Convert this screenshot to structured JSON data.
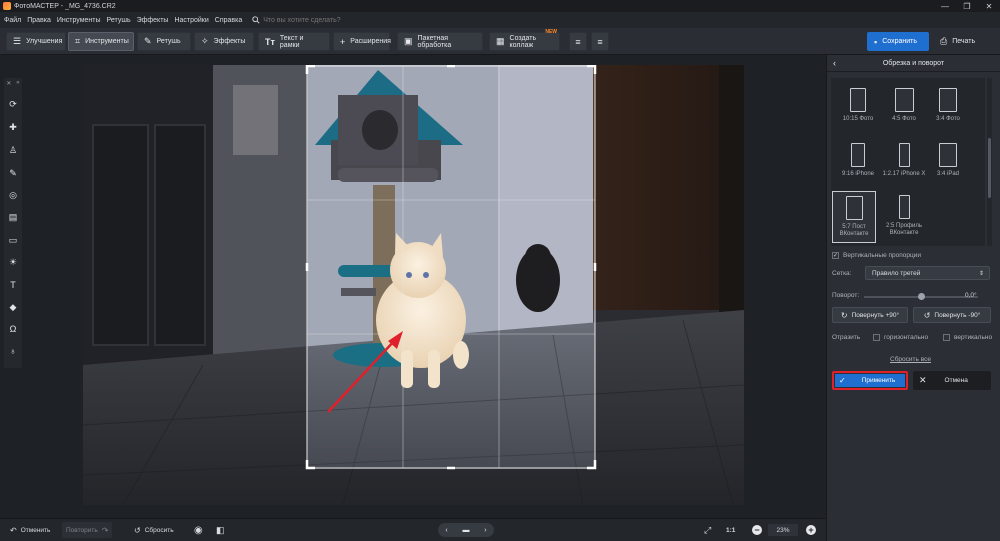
{
  "window": {
    "title": "ФотоМАСТЕР - _MG_4736.CR2",
    "minimize": "—",
    "maximize": "❐",
    "close": "✕"
  },
  "menu": {
    "items": [
      "Файл",
      "Правка",
      "Инструменты",
      "Ретушь",
      "Эффекты",
      "Настройки",
      "Справка"
    ],
    "search_placeholder": "Что вы хотите сделать?"
  },
  "toolbar": {
    "tabs": [
      {
        "label": "Улучшения",
        "icon": "sliders-icon"
      },
      {
        "label": "Инструменты",
        "icon": "crop-icon"
      },
      {
        "label": "Ретушь",
        "icon": "brush-icon"
      },
      {
        "label": "Эффекты",
        "icon": "sparkle-icon"
      },
      {
        "label": "Текст и рамки",
        "icon": "text-icon"
      },
      {
        "label": "Расширения",
        "icon": "plus-icon"
      }
    ],
    "batch_label": "Пакетная обработка",
    "collage_label": "Создать коллаж",
    "collage_badge": "NEW",
    "save_label": "Сохранить",
    "print_label": "Печать"
  },
  "left_tools": [
    "rotate-crop-icon",
    "patch-icon",
    "stamp-icon",
    "brush-icon",
    "radial-icon",
    "gradient-icon",
    "vignette-icon",
    "light-icon",
    "text-tool-icon",
    "fill-icon",
    "magnet-icon",
    "bulb-icon"
  ],
  "panel": {
    "title": "Обрезка и поворот",
    "presets": [
      {
        "label": "10:15 Фото"
      },
      {
        "label": "4:5 Фото"
      },
      {
        "label": "3:4 Фото"
      },
      {
        "label": "9:16 iPhone"
      },
      {
        "label": "1:2.17 iPhone X"
      },
      {
        "label": "3:4 iPad"
      },
      {
        "label": "5:7 Пост ВКонтакте",
        "selected": true
      },
      {
        "label": "2:5 Профиль ВКонтакте"
      }
    ],
    "vertical_proportions_label": "Вертикальные пропорции",
    "grid_label": "Сетка:",
    "grid_value": "Правило третей",
    "rotation_label": "Поворот:",
    "rotation_value": "0,0°",
    "rotation_level": 0.5,
    "rotate_plus_label": "Повернуть +90°",
    "rotate_minus_label": "Повернуть -90°",
    "flip_label": "Отразить",
    "flip_horizontal_label": "горизонтально",
    "flip_vertical_label": "вертикально",
    "reset_label": "Сбросить все",
    "apply_label": "Применить",
    "cancel_label": "Отмена"
  },
  "bottom": {
    "undo_label": "Отменить",
    "redo_label": "Повторить",
    "reset_label": "Сбросить",
    "zoom_ratio_label": "1:1",
    "zoom_value": "23%"
  },
  "colors": {
    "accent": "#1f6fd1",
    "highlight": "#e0202a",
    "panel": "#2b2e34"
  }
}
